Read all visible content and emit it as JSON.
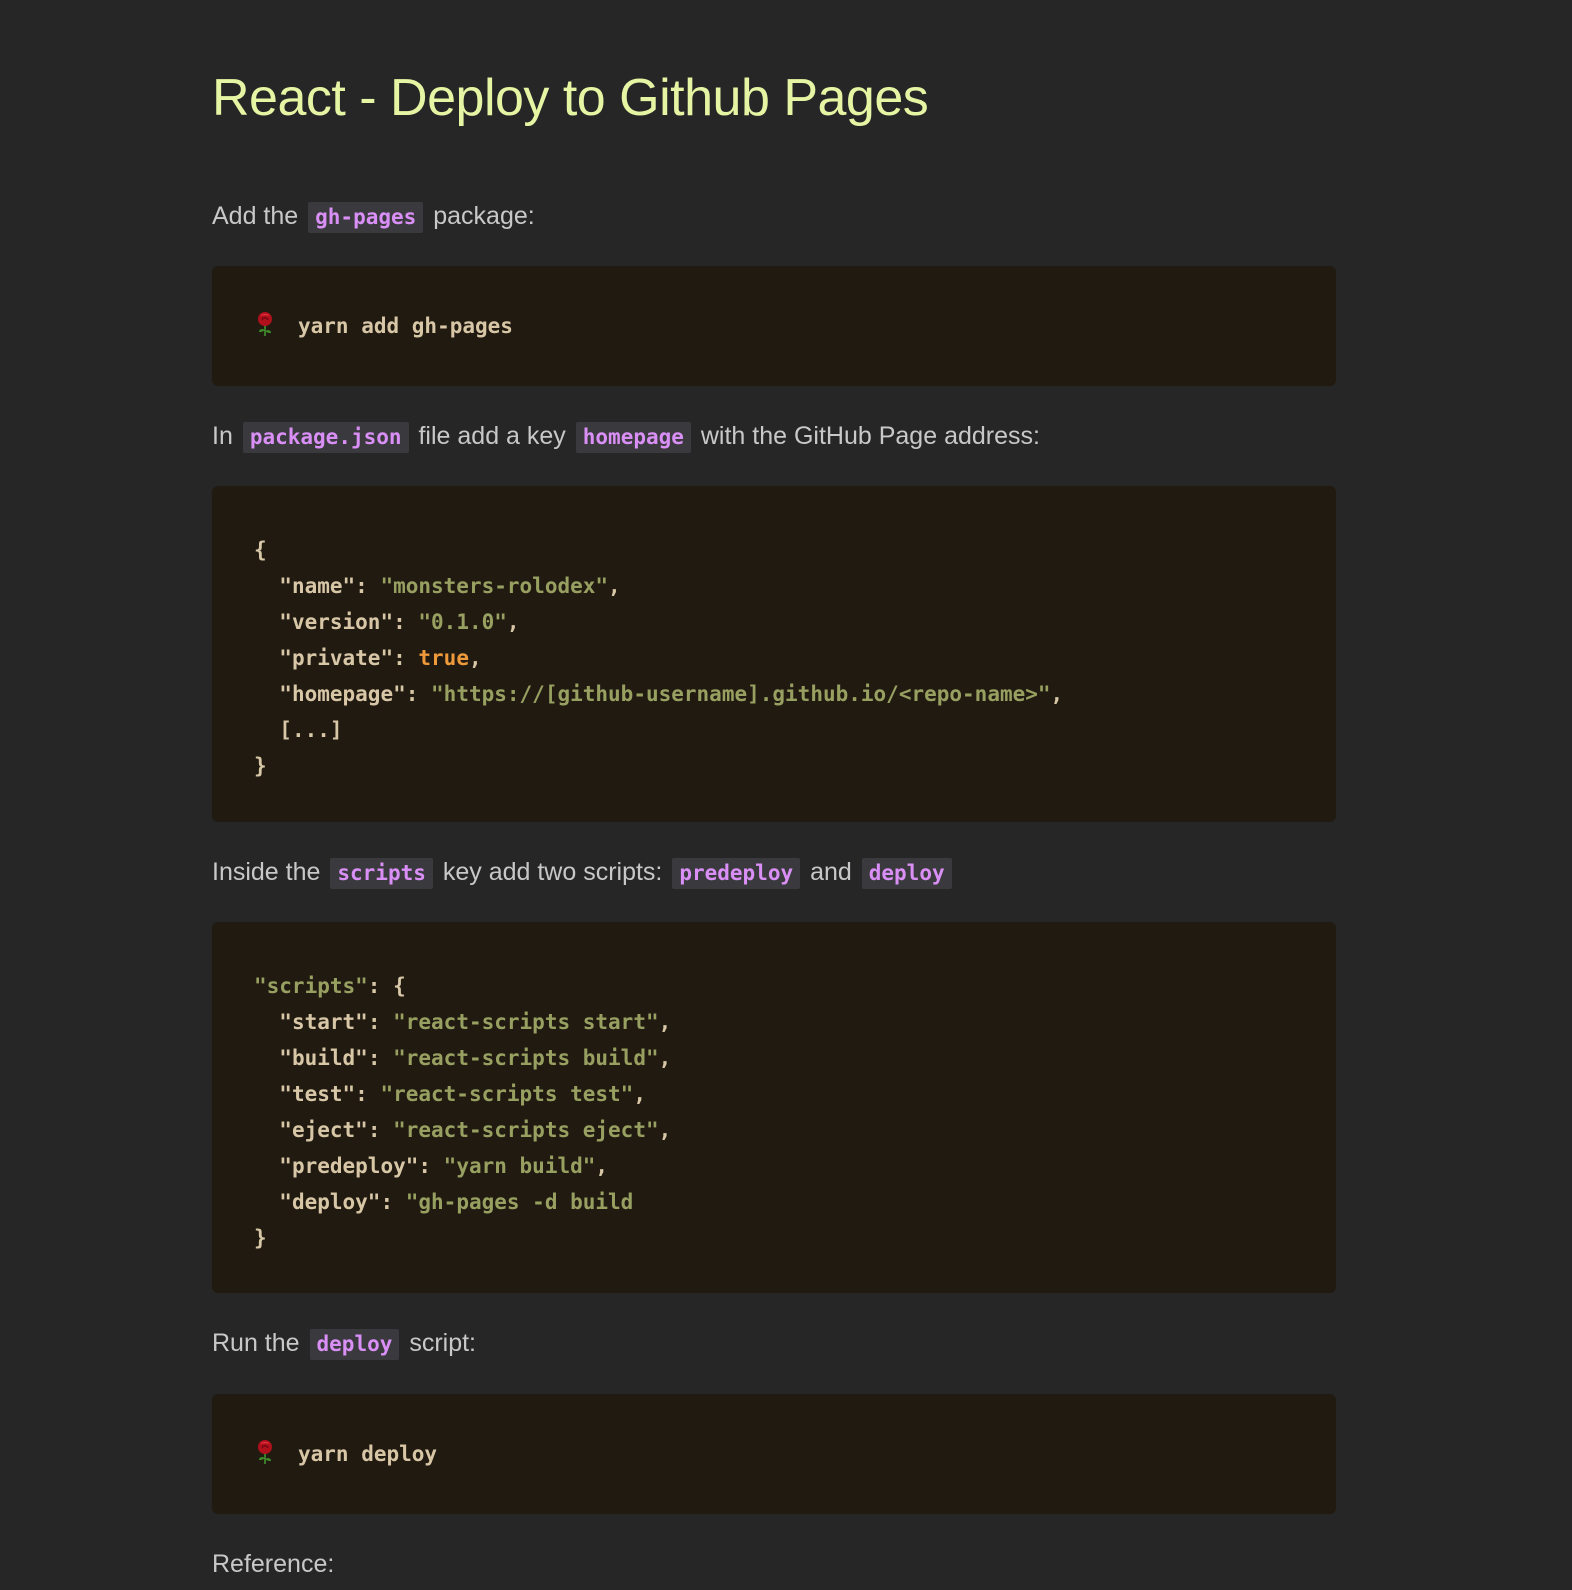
{
  "title": "React - Deploy to Github Pages",
  "step1": {
    "before": "Add the",
    "code": "gh-pages",
    "after": "package:",
    "command": "yarn add gh-pages"
  },
  "step2": {
    "t1": "In",
    "c1": "package.json",
    "t2": "file add a key",
    "c2": "homepage",
    "t3": "with the GitHub Page address:",
    "json": {
      "open": "{",
      "k_name": "\"name\"",
      "v_name": "\"monsters-rolodex\"",
      "k_version": "\"version\"",
      "v_version": "\"0.1.0\"",
      "k_private": "\"private\"",
      "v_private": "true",
      "k_homepage": "\"homepage\"",
      "v_homepage": "\"https://[github-username].github.io/<repo-name>\"",
      "ellipsis": "[...]",
      "close": "}"
    }
  },
  "step3": {
    "t1": "Inside the",
    "c1": "scripts",
    "t2": "key add two scripts:",
    "c2": "predeploy",
    "t3": "and",
    "c3": "deploy",
    "scripts": {
      "k_scripts": "\"scripts\"",
      "open": "{",
      "k_start": "\"start\"",
      "v_start": "\"react-scripts start\"",
      "k_build": "\"build\"",
      "v_build": "\"react-scripts build\"",
      "k_test": "\"test\"",
      "v_test": "\"react-scripts test\"",
      "k_eject": "\"eject\"",
      "v_eject": "\"react-scripts eject\"",
      "k_predeploy": "\"predeploy\"",
      "v_predeploy": "\"yarn build\"",
      "k_deploy": "\"deploy\"",
      "v_deploy": "\"gh-pages -d build",
      "close": "}"
    }
  },
  "step4": {
    "before": "Run the",
    "code": "deploy",
    "after": "script:",
    "command": "yarn deploy"
  },
  "reference": "Reference:",
  "icons": {
    "prompt": "rose-icon"
  },
  "colors": {
    "background": "#262627",
    "title": "#e6f5a3",
    "inline_code": "#d98ff5",
    "code_bg": "#211a11",
    "string": "#97a060",
    "boolean": "#ef9a3a"
  }
}
